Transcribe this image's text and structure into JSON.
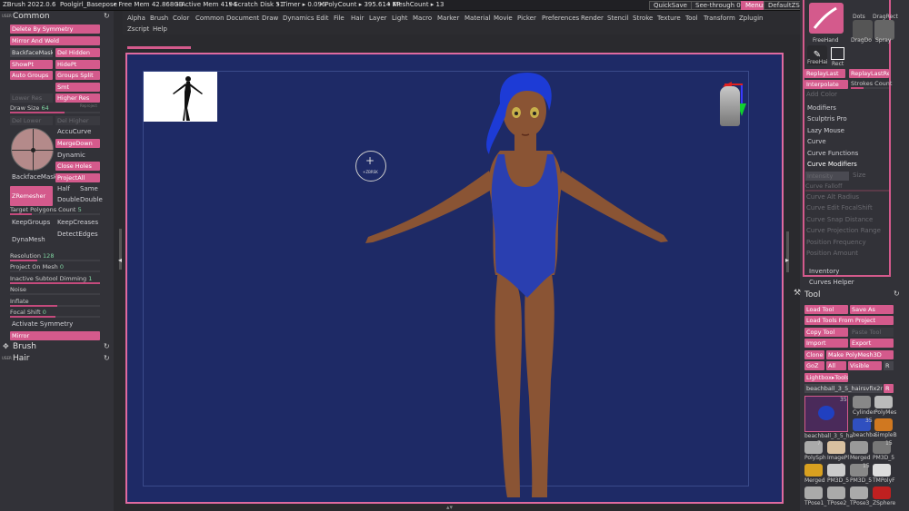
{
  "titlebar": {
    "app": "ZBrush 2022.0.6",
    "doc": "Poolgirl_Basepose",
    "free_mem": "• Free Mem 42.868GB",
    "active_mem": "• Active Mem 4194",
    "scratch": "• Scratch Disk 51",
    "timer": "• Timer ▸ 0.096",
    "polycount": "• PolyCount ▸ 395.614 KP",
    "meshcount": "• MeshCount ▸ 13",
    "quicksave": "QuickSave",
    "seethrough": "See-through  0",
    "menus": "Menus",
    "defaultzscript": "DefaultZScript"
  },
  "menu": {
    "row1": [
      "Alpha",
      "Brush",
      "Color",
      "Common",
      "Document",
      "Draw",
      "Dynamics",
      "Edit",
      "File",
      "Hair",
      "Layer",
      "Light",
      "Macro",
      "Marker",
      "Material",
      "Movie",
      "Picker",
      "Preferences",
      "Render",
      "Stencil",
      "Stroke",
      "Texture",
      "Tool",
      "Transform",
      "Zplugin"
    ],
    "row2": [
      "Zscript",
      "Help"
    ]
  },
  "left": {
    "user_common": "USER",
    "common_title": "Common",
    "delete_sym": "Delete By Symmetry",
    "mirror_weld": "Mirror And Weld",
    "backface_mask": "BackfaceMask",
    "del_hidden": "Del Hidden",
    "showpt": "ShowPt",
    "hidept": "HidePt",
    "auto_groups": "Auto Groups",
    "groups_split": "Groups Split",
    "smt": "Smt",
    "lower_res": "Lower Res",
    "higher_res": "Higher Res",
    "reproject": "Reproject",
    "draw_size_label": "Draw Size",
    "draw_size_value": "64",
    "del_lower": "Del Lower",
    "del_higher": "Del Higher",
    "accucurve": "AccuCurve",
    "mergedown": "MergeDown",
    "dynamic": "Dynamic",
    "close_holes": "Close Holes",
    "backface_mask2": "BackfaceMask",
    "projectall": "ProjectAll",
    "zremesher": "ZRemesher",
    "half": "Half",
    "same": "Same",
    "double1": "Double",
    "double2": "Double",
    "target_poly_label": "Target Polygons Count",
    "target_poly_value": "5",
    "keepgroups": "KeepGroups",
    "keepcreases": "KeepCreases",
    "detectedges": "DetectEdges",
    "dynamesh": "DynaMesh",
    "resolution_label": "Resolution",
    "resolution_value": "128",
    "project_on_mesh_label": "Project On Mesh",
    "project_on_mesh_value": "0",
    "inactive_label": "Inactive Subtool Dimming",
    "inactive_value": "1",
    "noise": "Noise",
    "inflate": "Inflate",
    "focal_label": "Focal Shift",
    "focal_value": "0",
    "activate_symmetry": "Activate Symmetry",
    "mirror": "Mirror",
    "brush_title": "Brush",
    "user_hair": "USER",
    "hair_title": "Hair"
  },
  "viewport": {
    "cursor_label": "+ZBRSK"
  },
  "right": {
    "dots": "Dots",
    "dragrect": "DragRect",
    "freehand": "FreeHand",
    "dragdot": "DragDo",
    "spray": "Spray",
    "freehair": "FreeHai",
    "rect": "Rect",
    "replaylast": "ReplayLast",
    "replaylastrel": "ReplayLastRel",
    "interpolate": "Interpolate",
    "strokes_count": "Strokes Count",
    "add_color": "Add Color",
    "modifiers": "Modifiers",
    "sculptris_pro": "Sculptris Pro",
    "lazy_mouse": "Lazy Mouse",
    "curve": "Curve",
    "curve_functions": "Curve Functions",
    "curve_modifiers": "Curve Modifiers",
    "intensity": "Intensity",
    "size": "Size",
    "curve_falloff": "Curve Falloff",
    "curve_alt_radius": "Curve Alt Radius",
    "curve_edit_focal": "Curve Edit FocalShift",
    "curve_snap": "Curve Snap Distance",
    "curve_projection": "Curve Projection Range",
    "position_frequency": "Position Frequency",
    "position_amount": "Position Amount",
    "inventory": "Inventory",
    "curves_helper": "Curves Helper",
    "tool_title": "Tool",
    "load_tool": "Load Tool",
    "save_as": "Save As",
    "load_from_project": "Load Tools From Project",
    "copy_tool": "Copy Tool",
    "paste_tool": "Paste Tool",
    "import": "Import",
    "export": "Export",
    "clone": "Clone",
    "make_polymesh": "Make PolyMesh3D",
    "goz": "GoZ",
    "all": "All",
    "visible": "Visible",
    "r1": "R",
    "lightbox_tools": "Lightbox▸Tools",
    "current_tool": "beachball_3_5_hairsvfix2ndsl",
    "r2": "R",
    "big_thumb_count": "35",
    "big_thumb_name": "beachball_3_5_ha",
    "thumbs": [
      {
        "name": "Cylinder",
        "count": ""
      },
      {
        "name": "PolyMes",
        "count": ""
      },
      {
        "name": "beachba",
        "count": "35"
      },
      {
        "name": "SimpleB",
        "count": ""
      },
      {
        "name": "PolySph",
        "count": "7"
      },
      {
        "name": "ImagePl",
        "count": ""
      },
      {
        "name": "Merged",
        "count": ""
      },
      {
        "name": "PM3D_5",
        "count": "15"
      },
      {
        "name": "Merged",
        "count": ""
      },
      {
        "name": "PM3D_5",
        "count": "7"
      },
      {
        "name": "PM3D_5",
        "count": "15"
      },
      {
        "name": "TMPolyF",
        "count": ""
      },
      {
        "name": "TPose1_",
        "count": ""
      },
      {
        "name": "TPose2_",
        "count": ""
      },
      {
        "name": "TPose3_",
        "count": ""
      },
      {
        "name": "ZSphere",
        "count": ""
      }
    ]
  },
  "colors": {
    "accent": "#d45a8c",
    "viewport_bg": "#1e2a66",
    "frame": "#e06aa0",
    "swimsuit": "#2a3fb0",
    "hair": "#1d3bd6",
    "skin": "#8a5434"
  }
}
